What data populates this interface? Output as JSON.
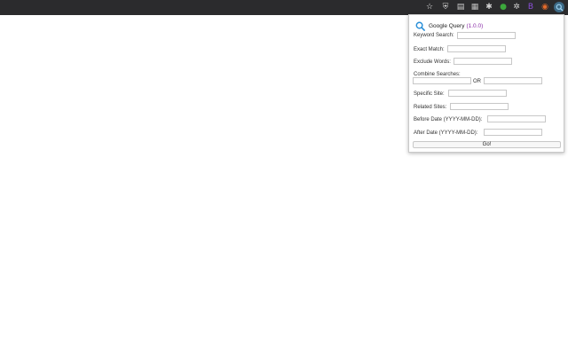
{
  "browser": {
    "toolbar_icons": [
      {
        "name": "star-icon",
        "glyph": "☆",
        "color": "#e8e8e8"
      },
      {
        "name": "shield-icon",
        "glyph": "⛨",
        "color": "#d0d0d0"
      },
      {
        "name": "comment-icon",
        "glyph": "▤",
        "color": "#d0d0d0"
      },
      {
        "name": "puzzle-icon",
        "glyph": "▦",
        "color": "#bdbdbd"
      },
      {
        "name": "settings-ext-icon",
        "glyph": "✱",
        "color": "#d0d0d0"
      },
      {
        "name": "green-ext-icon",
        "glyph": "●",
        "color": "#3ca83c"
      },
      {
        "name": "gear-icon",
        "glyph": "✲",
        "color": "#d0d0d0"
      },
      {
        "name": "b-ext-icon",
        "glyph": "B",
        "color": "#8a4fd8"
      },
      {
        "name": "orange-ext-icon",
        "glyph": "◉",
        "color": "#e36a2a"
      },
      {
        "name": "window-ext-icon",
        "glyph": "▬",
        "color": "#3b9be0"
      },
      {
        "name": "google-query-ext-icon",
        "glyph": "🔍",
        "color": "#2a8fd8"
      }
    ]
  },
  "popup": {
    "title": "Google Query",
    "version": "(1.0.0)",
    "search_icon_color": "#2a8fd8",
    "fields": {
      "keyword_search": {
        "label": "Keyword Search:",
        "value": ""
      },
      "exact_match": {
        "label": "Exact Match:",
        "value": ""
      },
      "exclude_words": {
        "label": "Exclude Words:",
        "value": ""
      },
      "combine_searches": {
        "label": "Combine Searches:",
        "left_value": "",
        "or_label": "OR",
        "right_value": ""
      },
      "specific_site": {
        "label": "Specific Site:",
        "value": ""
      },
      "related_sites": {
        "label": "Related Sites:",
        "value": ""
      },
      "before_date": {
        "label": "Before Date (YYYY-MM-DD):",
        "value": ""
      },
      "after_date": {
        "label": "After Date (YYYY-MM-DD):",
        "value": ""
      }
    },
    "go_button": "Go!"
  }
}
